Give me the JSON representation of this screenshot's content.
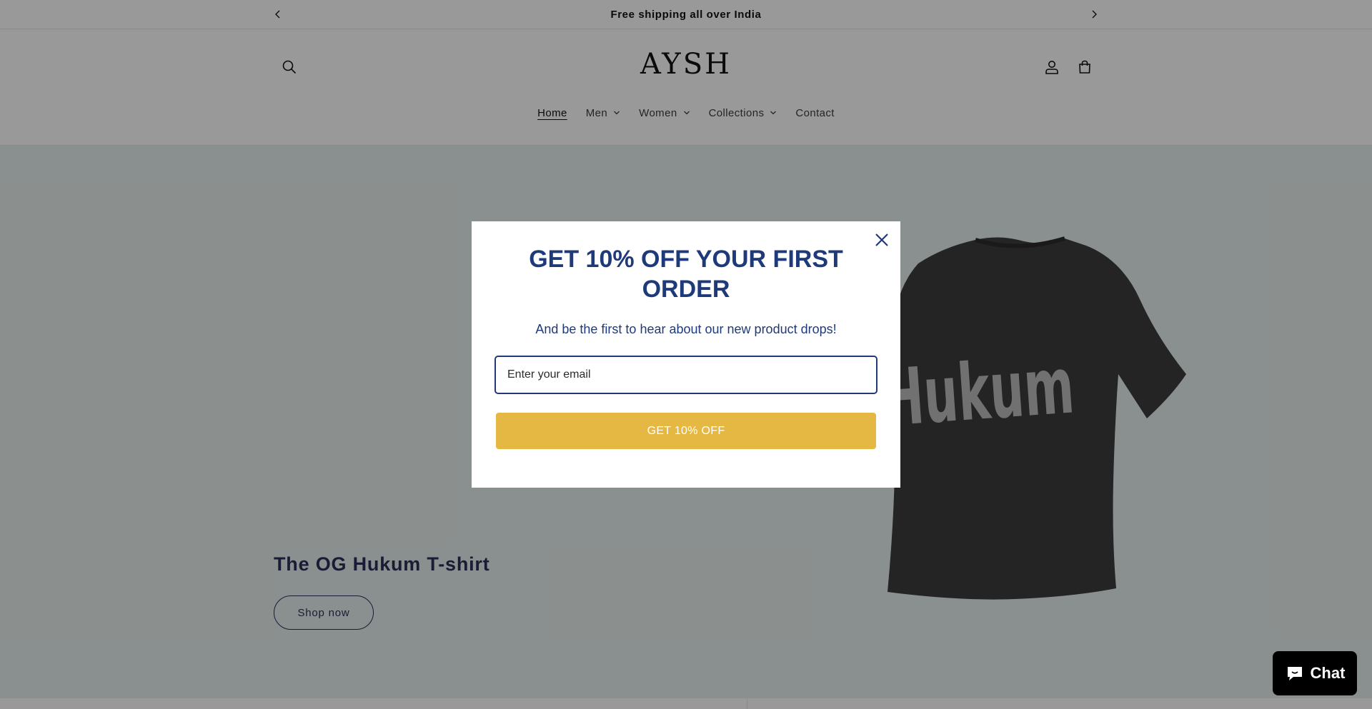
{
  "announcement": {
    "text": "Free shipping all over India"
  },
  "header": {
    "logo_text": "AYSH",
    "nav": [
      {
        "label": "Home",
        "active": true,
        "has_dropdown": false
      },
      {
        "label": "Men",
        "active": false,
        "has_dropdown": true
      },
      {
        "label": "Women",
        "active": false,
        "has_dropdown": true
      },
      {
        "label": "Collections",
        "active": false,
        "has_dropdown": true
      },
      {
        "label": "Contact",
        "active": false,
        "has_dropdown": false
      }
    ],
    "icons": [
      "search-icon",
      "account-icon",
      "cart-icon"
    ]
  },
  "hero": {
    "title": "The OG Hukum T-shirt",
    "button_label": "Shop now",
    "shirt_print": "Hukum",
    "background_color": "#e7f0ef",
    "accent_color": "#2a2f57"
  },
  "popup": {
    "title": "GET 10% OFF YOUR FIRST ORDER",
    "subtitle": "And be the first to hear about our new product drops!",
    "email_placeholder": "Enter your email",
    "email_value": "",
    "submit_label": "GET 10% OFF",
    "title_color": "#1f3a7a",
    "button_color": "#e5b843"
  },
  "chat": {
    "label": "Chat"
  }
}
